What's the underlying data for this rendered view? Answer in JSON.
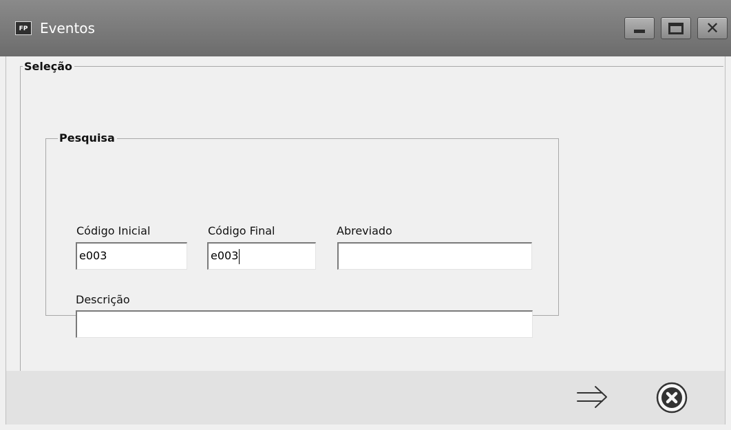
{
  "window": {
    "title": "Eventos",
    "app_icon_text": "FP",
    "controls": [
      "minimize",
      "maximize",
      "close"
    ]
  },
  "selecao": {
    "legend": "Seleção"
  },
  "pesquisa": {
    "legend": "Pesquisa",
    "fields": {
      "codigo_inicial": {
        "label": "Código Inicial",
        "value": "e003"
      },
      "codigo_final": {
        "label": "Código Final",
        "value": "e003"
      },
      "abreviado": {
        "label": "Abreviado",
        "value": ""
      },
      "descricao": {
        "label": "Descrição",
        "value": ""
      }
    }
  },
  "actions": {
    "confirm_icon": "double-arrow-right-icon",
    "cancel_icon": "circle-x-icon"
  },
  "colors": {
    "titlebar": "#7a7a7a",
    "window_bg": "#f0f0f0",
    "bottom_bar": "#e2e2e2",
    "icon_stroke": "#333333"
  }
}
